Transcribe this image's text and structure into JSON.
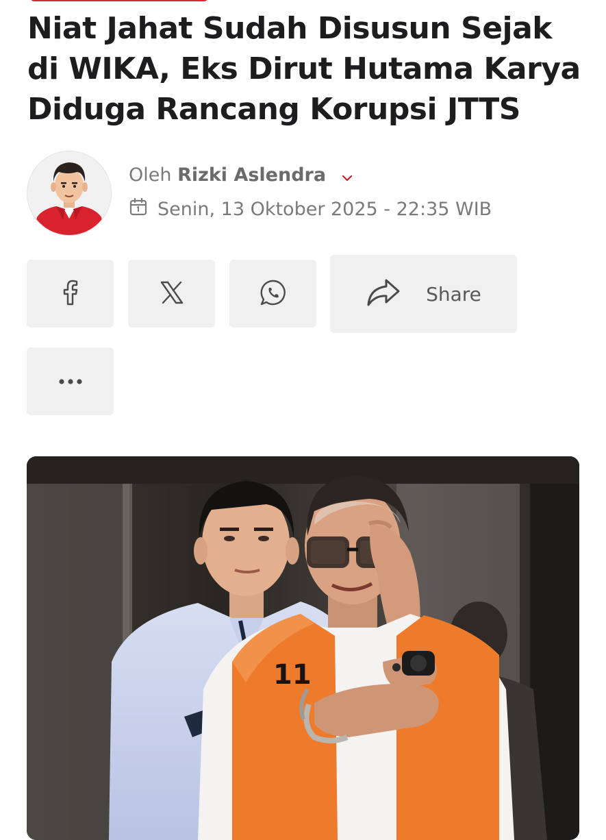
{
  "article": {
    "headline": "Niat Jahat Sudah Disusun Sejak di WIKA, Eks Dirut Hutama Karya Diduga Rancang Korupsi JTTS",
    "byline_prefix": "Oleh",
    "author": "Rizki Aslendra",
    "date": "Senin, 13 Oktober 2025 - 22:35 WIB"
  },
  "share": {
    "share_label": "Share",
    "buttons": [
      "facebook-icon",
      "x-icon",
      "whatsapp-icon",
      "share-arrow-icon",
      "more-dots-icon"
    ]
  },
  "photo": {
    "vest_number": "11"
  },
  "colors": {
    "accent": "#d6263a",
    "button_bg": "#f0f0f0",
    "text_dark": "#1d1d1f",
    "text_muted": "#7a7a7a",
    "vest_orange": "#ee7a2c"
  }
}
